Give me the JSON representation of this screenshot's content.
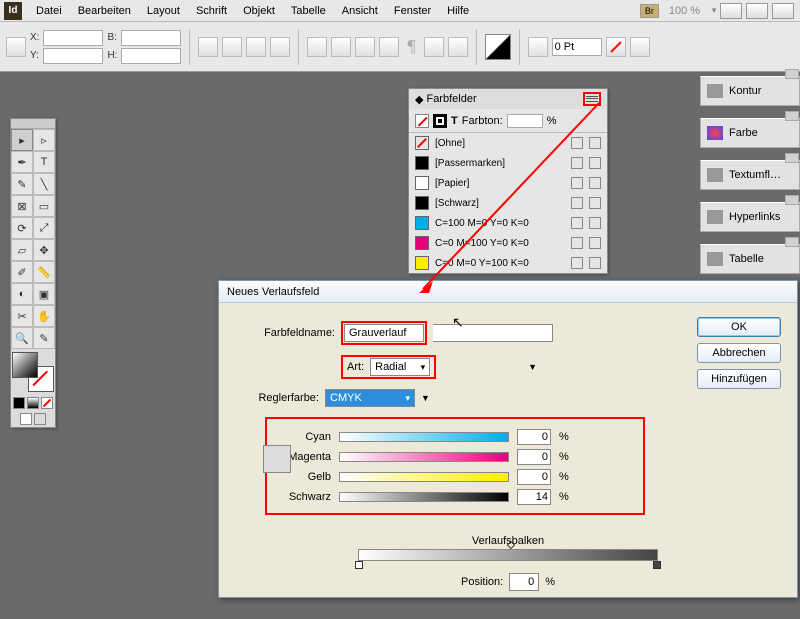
{
  "menu": {
    "items": [
      "Datei",
      "Bearbeiten",
      "Layout",
      "Schrift",
      "Objekt",
      "Tabelle",
      "Ansicht",
      "Fenster",
      "Hilfe"
    ],
    "br": "Br",
    "zoom": "100 %"
  },
  "ctrl": {
    "x": "X:",
    "y": "Y:",
    "b": "B:",
    "h": "H:",
    "pt": "0 Pt"
  },
  "rpanels": [
    "Kontur",
    "Farbe",
    "Textumfl…",
    "Hyperlinks",
    "Tabelle"
  ],
  "swatches": {
    "title": "Farbfelder",
    "tintlabel": "Farbton:",
    "tintpct": "%",
    "rows": [
      {
        "name": "[Ohne]",
        "color": "transparent",
        "nored": true
      },
      {
        "name": "[Passermarken]",
        "color": "#000"
      },
      {
        "name": "[Papier]",
        "color": "#fff"
      },
      {
        "name": "[Schwarz]",
        "color": "#000"
      },
      {
        "name": "C=100 M=0 Y=0 K=0",
        "color": "#00aee6"
      },
      {
        "name": "C=0 M=100 Y=0 K=0",
        "color": "#e6007e"
      },
      {
        "name": "C=0 M=0 Y=100 K=0",
        "color": "#ffed00"
      }
    ]
  },
  "dialog": {
    "title": "Neues Verlaufsfeld",
    "name_label": "Farbfeldname:",
    "name_value": "Grauverlauf",
    "type_label": "Art:",
    "type_value": "Radial",
    "stopcolor_label": "Reglerfarbe:",
    "stopcolor_value": "CMYK",
    "ok": "OK",
    "cancel": "Abbrechen",
    "add": "Hinzufügen",
    "channels": [
      {
        "label": "Cyan",
        "cls": "cyan",
        "val": "0"
      },
      {
        "label": "Magenta",
        "cls": "magenta",
        "val": "0"
      },
      {
        "label": "Gelb",
        "cls": "yellow",
        "val": "0"
      },
      {
        "label": "Schwarz",
        "cls": "black",
        "val": "14"
      }
    ],
    "pct": "%",
    "ramp_label": "Verlaufsbalken",
    "pos_label": "Position:",
    "pos_value": "0"
  }
}
